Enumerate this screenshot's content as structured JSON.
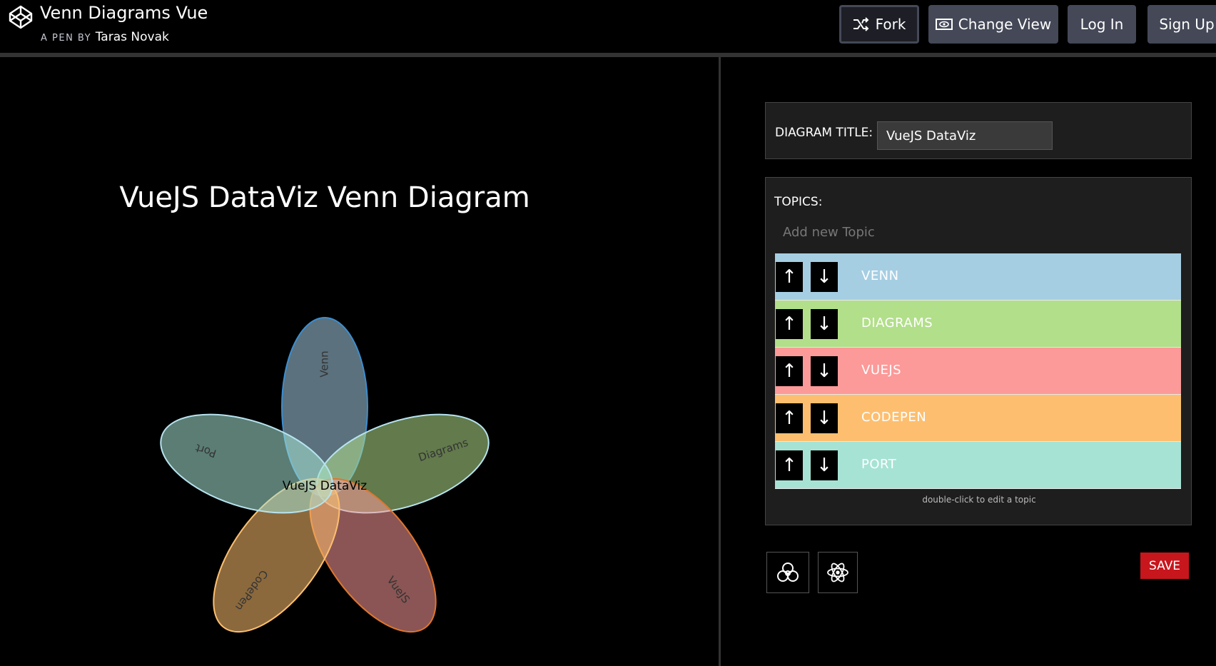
{
  "header": {
    "pen_title": "Venn Diagrams Vue",
    "by_label": "A PEN BY",
    "author": "Taras Novak",
    "buttons": {
      "fork": "Fork",
      "change_view": "Change View",
      "log_in": "Log In",
      "sign_up": "Sign Up"
    }
  },
  "diagram": {
    "title": "VueJS DataViz Venn Diagram",
    "center_label": "VueJS DataViz",
    "sets": [
      {
        "label": "Venn",
        "color": "#a6cee3"
      },
      {
        "label": "Diagrams",
        "color": "#b2df8a"
      },
      {
        "label": "VueJS",
        "color": "#fb9a99"
      },
      {
        "label": "CodePen",
        "color": "#fdbf6f"
      },
      {
        "label": "Port",
        "color": "#a6e3d4"
      }
    ]
  },
  "settings": {
    "title_label": "DIAGRAM TITLE:",
    "title_value": "VueJS DataViz",
    "topics_label": "TOPICS:",
    "add_placeholder": "Add new Topic",
    "topics": [
      {
        "label": "VENN",
        "color": "#a6cee3"
      },
      {
        "label": "DIAGRAMS",
        "color": "#b2df8a"
      },
      {
        "label": "VUEJS",
        "color": "#fb9a99"
      },
      {
        "label": "CODEPEN",
        "color": "#fdbf6f"
      },
      {
        "label": "PORT",
        "color": "#a6e3d4"
      }
    ],
    "up_arrow": "↑",
    "down_arrow": "↓",
    "hint": "double-click to edit a topic",
    "save_label": "SAVE"
  }
}
